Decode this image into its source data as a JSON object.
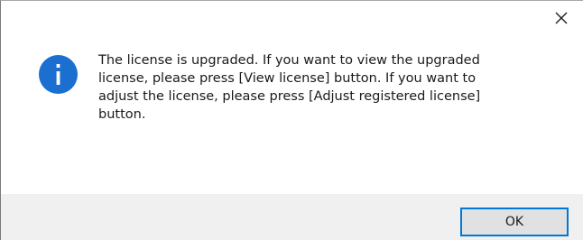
{
  "dialog": {
    "message": "The license is upgraded. If you want to view the upgraded\nlicense, please press [View license] button. If you want to\nadjust the license, please press [Adjust registered license]\nbutton.",
    "ok_label": "OK",
    "icon": "info-icon",
    "close_icon": "close-icon"
  },
  "colors": {
    "info_icon_bg": "#1a6fd0",
    "button_border": "#0078d7",
    "footer_bg": "#f0f0f0"
  }
}
